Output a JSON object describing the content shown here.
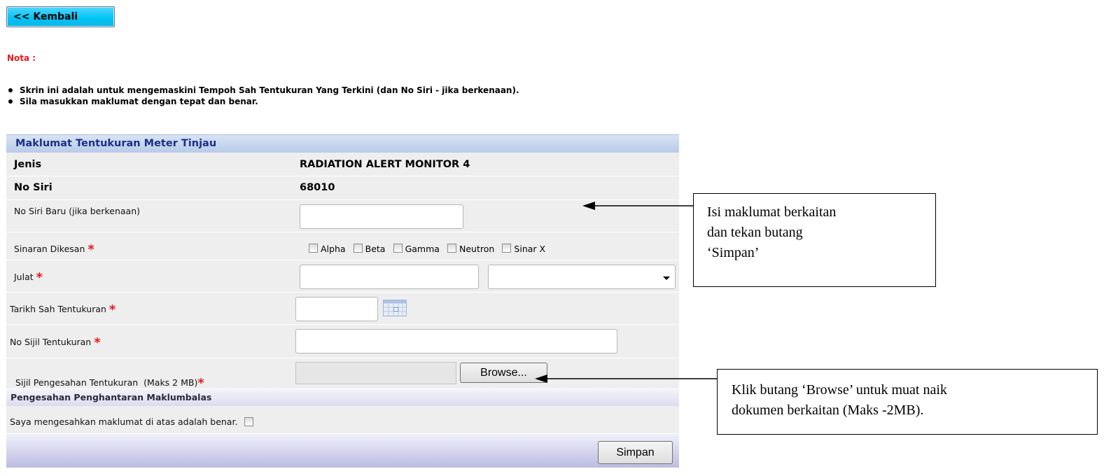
{
  "back_button": {
    "label": "<< Kembali"
  },
  "nota": {
    "title": "Nota :",
    "lines": [
      "Skrin ini adalah untuk mengemaskini Tempoh Sah Tentukuran Yang Terkini (dan No Siri - jika berkenaan).",
      "Sila masukkan maklumat dengan tepat dan benar."
    ]
  },
  "form": {
    "header": "Maklumat Tentukuran Meter Tinjau",
    "jenis": {
      "label": "Jenis",
      "value": "RADIATION ALERT MONITOR 4"
    },
    "no_siri": {
      "label": "No Siri",
      "value": "68010"
    },
    "no_siri_baru": {
      "label": "No Siri Baru (jika berkenaan)",
      "value": ""
    },
    "sinaran": {
      "label": "Sinaran Dikesan",
      "options": [
        "Alpha",
        "Beta",
        "Gamma",
        "Neutron",
        "Sinar X"
      ]
    },
    "julat": {
      "label": "Julat",
      "value": "",
      "unit_selected": ""
    },
    "tarikh": {
      "label": "Tarikh Sah Tentukuran",
      "value": ""
    },
    "no_sijil": {
      "label": "No Sijil Tentukuran",
      "value": ""
    },
    "sijil_upload": {
      "label": "Sijil Pengesahan Tentukuran  (Maks 2 MB)",
      "browse_label": "Browse..."
    },
    "required_mark": "*",
    "pengesahan": {
      "header": "Pengesahan Penghantaran Maklumbalas",
      "label": "Saya mengesahkan maklumat di atas adalah benar."
    },
    "save_label": "Simpan"
  },
  "callouts": {
    "top": [
      "Isi maklumat berkaitan",
      "dan tekan butang",
      "‘Simpan’"
    ],
    "bottom": [
      "Klik butang ‘Browse’ untuk muat naik",
      "dokumen berkaitan (Maks -2MB)."
    ]
  },
  "colors": {
    "back_button": "#00c3f2",
    "nota_red": "#e8181e",
    "header_blue": "#1c2f8a",
    "row_gray": "#eeeeee"
  }
}
